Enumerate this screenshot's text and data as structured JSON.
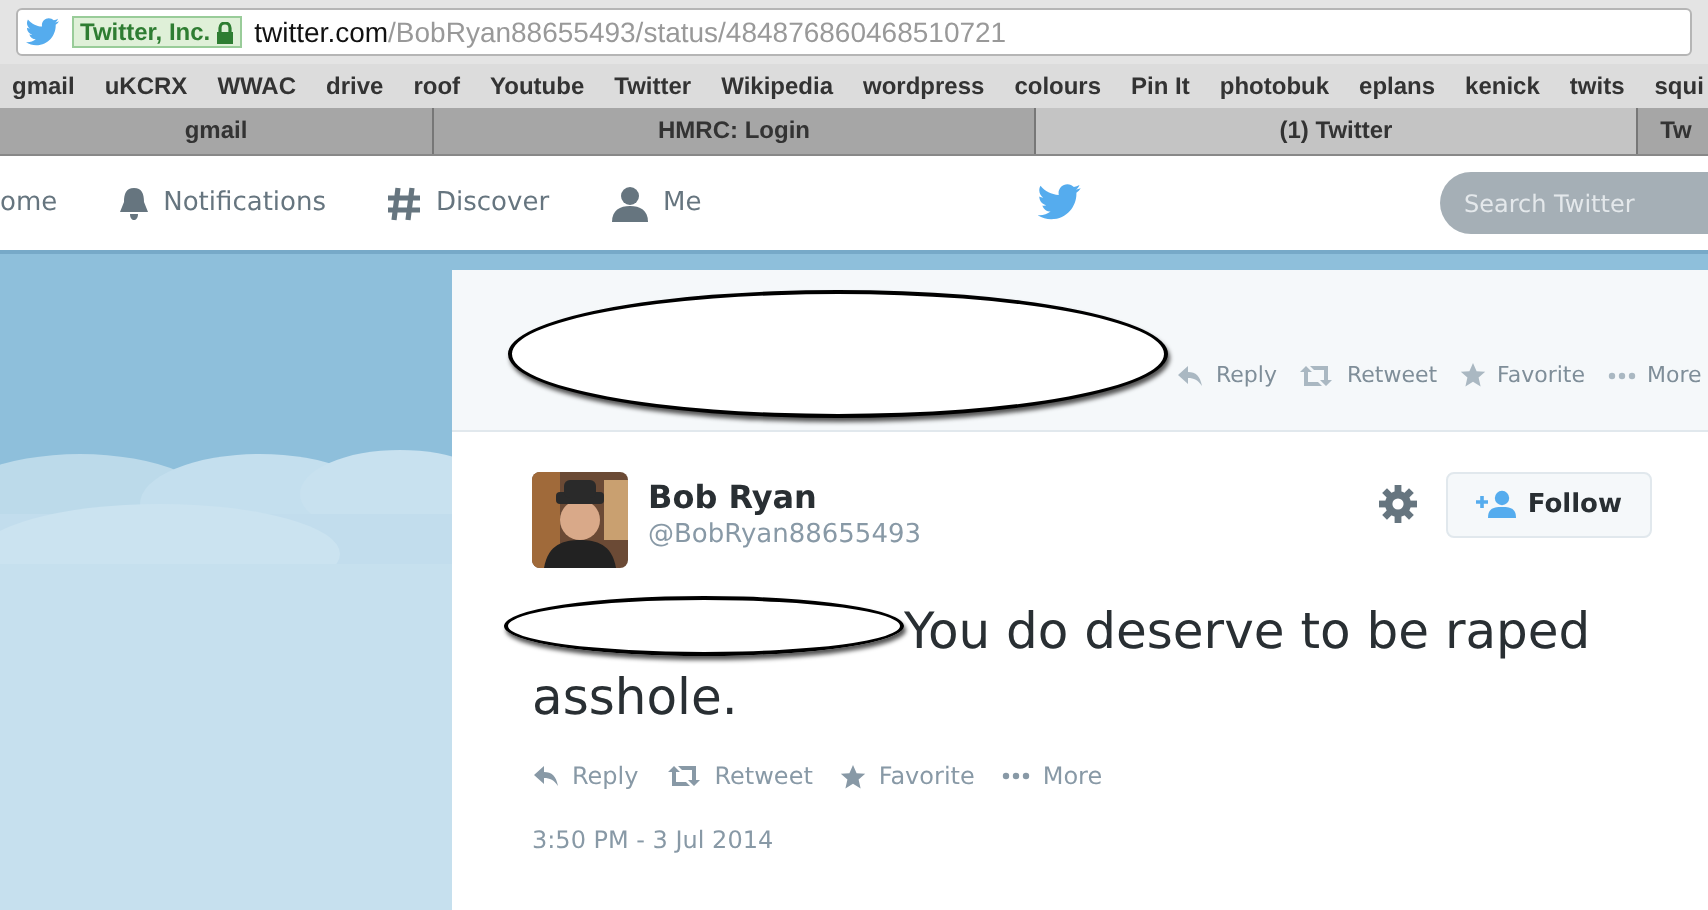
{
  "address_bar": {
    "site_badge": "Twitter, Inc.",
    "host": "twitter.com",
    "path": "/BobRyan88655493/status/484876860468510721"
  },
  "bookmarks": [
    "gmail",
    "uKCRX",
    "WWAC",
    "drive",
    "roof",
    "Youtube",
    "Twitter",
    "Wikipedia",
    "wordpress",
    "colours",
    "Pin It",
    "photobuk",
    "eplans",
    "kenick",
    "twits",
    "squi"
  ],
  "tabs": [
    {
      "label": "gmail",
      "selected": false
    },
    {
      "label": "HMRC: Login",
      "selected": false
    },
    {
      "label": "(1) Twitter",
      "selected": true
    },
    {
      "label": "Tw",
      "selected": false
    }
  ],
  "nav": {
    "items": [
      {
        "kind": "home",
        "label": "ome"
      },
      {
        "kind": "bell",
        "label": "Notifications"
      },
      {
        "kind": "hash",
        "label": "Discover"
      },
      {
        "kind": "person",
        "label": "Me"
      }
    ],
    "search": {
      "placeholder": "Search Twitter"
    }
  },
  "parent_tweet": {
    "actions": [
      {
        "kind": "reply",
        "label": "Reply"
      },
      {
        "kind": "retweet",
        "label": "Retweet"
      },
      {
        "kind": "favorite",
        "label": "Favorite"
      },
      {
        "kind": "more",
        "label": "More"
      }
    ]
  },
  "tweet": {
    "name": "Bob Ryan",
    "handle": "@BobRyan88655493",
    "follow": "Follow",
    "text": "You do deserve to be raped",
    "text_line2": "asshole.",
    "actions": [
      {
        "kind": "reply",
        "label": "Reply"
      },
      {
        "kind": "retweet",
        "label": "Retweet"
      },
      {
        "kind": "favorite",
        "label": "Favorite"
      },
      {
        "kind": "more",
        "label": "More"
      }
    ],
    "time": "3:50 PM - 3 Jul 2014"
  }
}
